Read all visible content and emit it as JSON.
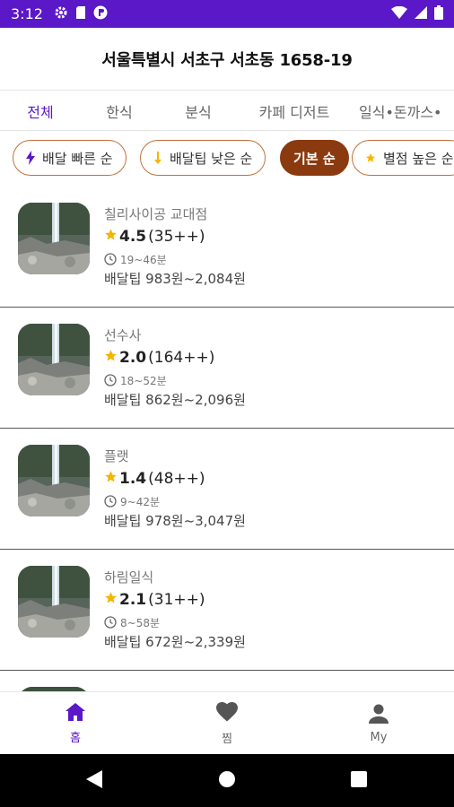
{
  "status_bar": {
    "time": "3:12"
  },
  "header": {
    "address": "서울특별시 서초구 서초동 1658-19"
  },
  "tabs": [
    {
      "label": "전체",
      "active": true
    },
    {
      "label": "한식",
      "active": false
    },
    {
      "label": "분식",
      "active": false
    },
    {
      "label": "카페 디저트",
      "active": false
    },
    {
      "label": "일식•돈까스•",
      "active": false
    }
  ],
  "sort_chips": [
    {
      "label": "배달 빠른 순",
      "icon": "lightning-icon",
      "active": false
    },
    {
      "label": "배달팁 낮은 순",
      "icon": "arrow-down-icon",
      "active": false
    },
    {
      "label": "기본 순",
      "icon": "",
      "active": true
    },
    {
      "label": "별점 높은 순",
      "icon": "star-icon",
      "active": false
    }
  ],
  "restaurants": [
    {
      "name": "칠리사이공 교대점",
      "rating": "4.5",
      "reviews": "(35++)",
      "time": "19~46분",
      "tip": "배달팁 983원~2,084원"
    },
    {
      "name": "선수사",
      "rating": "2.0",
      "reviews": "(164++)",
      "time": "18~52분",
      "tip": "배달팁 862원~2,096원"
    },
    {
      "name": "플랫",
      "rating": "1.4",
      "reviews": "(48++)",
      "time": "9~42분",
      "tip": "배달팁 978원~3,047원"
    },
    {
      "name": "하림일식",
      "rating": "2.1",
      "reviews": "(31++)",
      "time": "8~58분",
      "tip": "배달팁 672원~2,339원"
    }
  ],
  "bottom_nav": [
    {
      "label": "홈",
      "icon": "home-icon",
      "active": true
    },
    {
      "label": "찜",
      "icon": "heart-icon",
      "active": false
    },
    {
      "label": "My",
      "icon": "person-icon",
      "active": false
    }
  ],
  "colors": {
    "primary": "#5a18c8",
    "chip_border": "#c0703a",
    "chip_active": "#8b3a0f",
    "star": "#f5b400"
  }
}
